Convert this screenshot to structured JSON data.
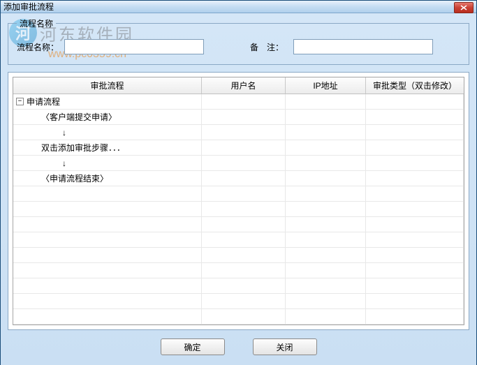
{
  "window": {
    "title": "添加审批流程"
  },
  "watermark": {
    "brand": "河东软件园",
    "url": "www.pc0359.cn"
  },
  "form": {
    "legend": "流程名称",
    "name_label": "流程名称：",
    "name_value": "",
    "remark_label": "备　注：",
    "remark_value": ""
  },
  "grid": {
    "headers": {
      "flow": "审批流程",
      "user": "用户名",
      "ip": "IP地址",
      "type": "审批类型（双击修改）"
    },
    "tree": {
      "root": "申请流程",
      "step1": "〈客户端提交申请〉",
      "step2": "双击添加审批步骤．．．",
      "step3": "〈申请流程结束〉",
      "arrow": "↓"
    }
  },
  "buttons": {
    "ok": "确定",
    "close": "关闭"
  }
}
